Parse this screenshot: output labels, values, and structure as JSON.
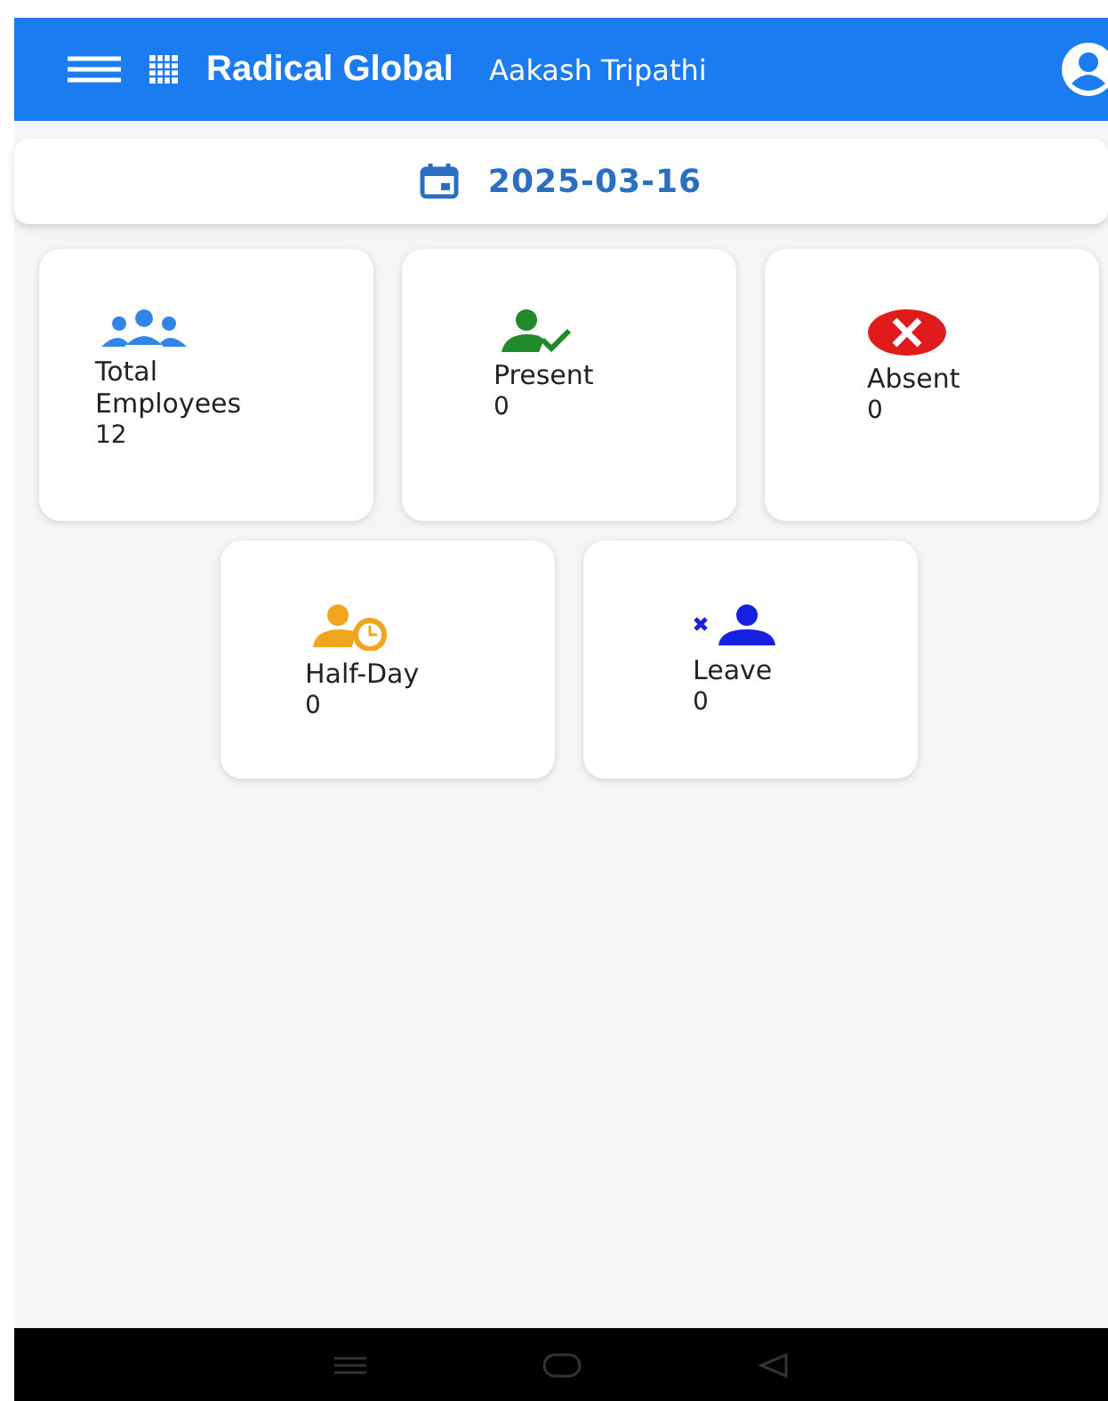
{
  "app_bar": {
    "title": "Radical Global",
    "user": "Aakash Tripathi"
  },
  "date": "2025-03-16",
  "stats": [
    {
      "kind": "group",
      "label": "Total Employees",
      "value": "12",
      "color": "#2f86e8"
    },
    {
      "kind": "present",
      "label": "Present",
      "value": "0",
      "color": "#1e8a2a"
    },
    {
      "kind": "absent",
      "label": "Absent",
      "value": "0",
      "color": "#e01b1b"
    },
    {
      "kind": "halfday",
      "label": "Half-Day",
      "value": "0",
      "color": "#f0a51c"
    },
    {
      "kind": "leave",
      "label": "Leave",
      "value": "0",
      "color": "#1422e0"
    }
  ]
}
